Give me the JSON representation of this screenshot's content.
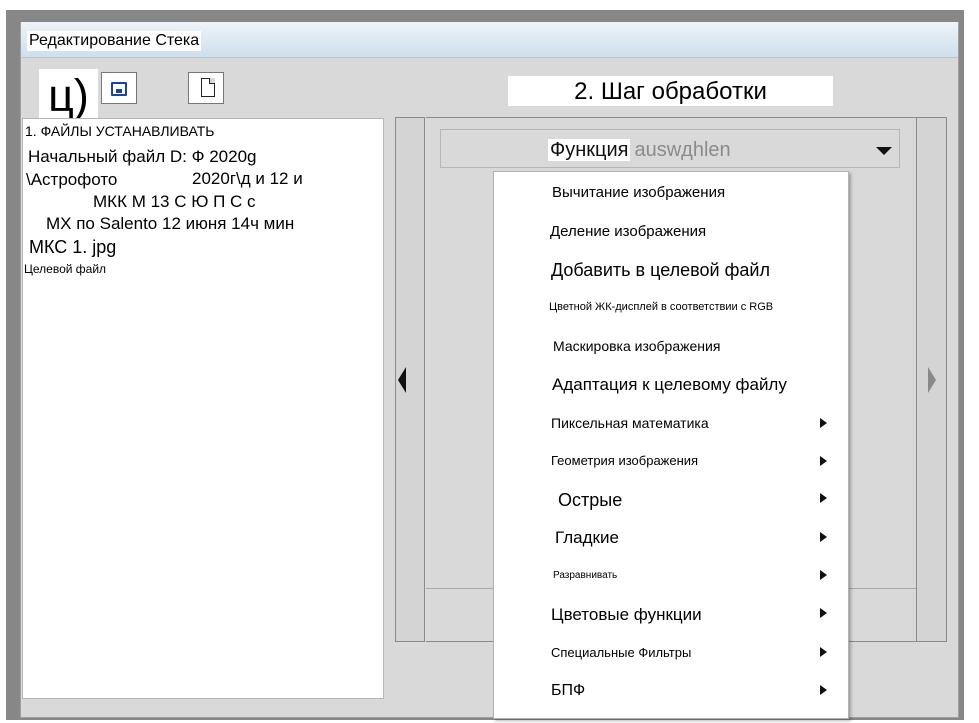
{
  "window": {
    "title": "Редактирование Стека",
    "top_label": "ц)",
    "step_title": "2. Шаг обработки"
  },
  "toolbar": {
    "save_icon": "save-icon",
    "new_icon": "new-file-icon"
  },
  "file_panel": {
    "lines": [
      "1. ФАЙЛЫ УСТАНАВЛИВАТЬ",
      "Начальный файл D: Ф 2020g",
      "\\Астрофото",
      "2020г\\д и 12 и",
      "МКК М 13 С Ю П С с",
      "МХ по Salento 12 июня 14ч мин",
      "МКС 1. jpg",
      "Целевой файл"
    ]
  },
  "function_select": {
    "label": "Функция",
    "placeholder": "auswдhlen"
  },
  "menu": {
    "items": [
      "Вычитание изображения",
      "Деление изображения",
      "Добавить в целевой файл",
      "Цветной ЖК-дисплей в соответствии с RGB",
      "Маскировка изображения",
      "Адаптация к целевому файлу",
      "Пиксельная математика",
      "Геометрия изображения",
      "Острые",
      "Гладкие",
      "Разравнивать",
      "Цветовые функции",
      "Специальные Фильтры",
      "БПФ"
    ]
  },
  "colors": {
    "frame_gray": "#d9d9d9",
    "save_blue": "#16469d"
  }
}
